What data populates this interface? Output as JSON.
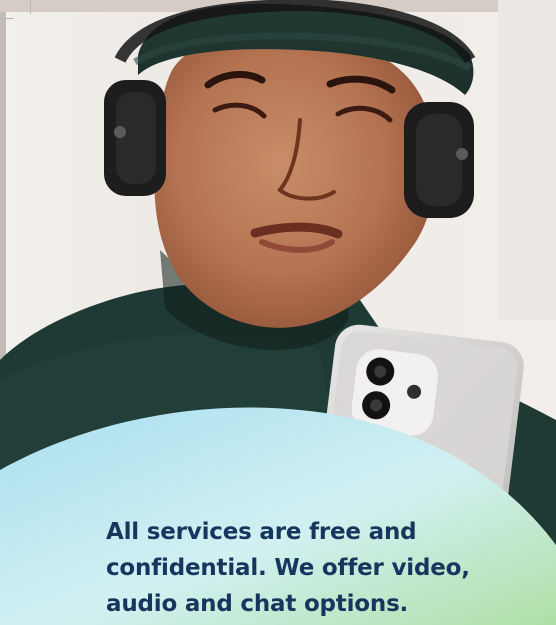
{
  "hero": {
    "image_alt": "Young person wearing headphones and a beanie looking at a smartphone",
    "headline": "All services are free and confidential. We offer video, audio and chat options."
  },
  "colors": {
    "headline": "#17365d",
    "gradient_start": "#a9dff0",
    "gradient_mid": "#d2f0f2",
    "gradient_end": "#aee0a6"
  }
}
